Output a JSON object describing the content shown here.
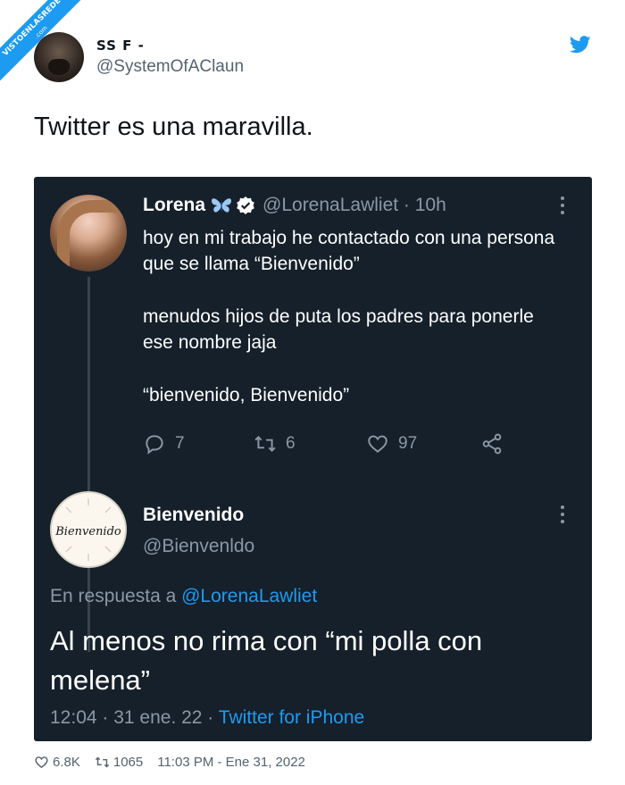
{
  "watermark": {
    "line1": "VISTOENLASREDES",
    "line2": ".com"
  },
  "outer_tweet": {
    "author_name": "SS F  -",
    "handle": "@SystemOfAClaun",
    "text": "Twitter es una maravilla.",
    "likes": "6.8K",
    "retweets": "1065",
    "timestamp": "11:03 PM - Ene 31, 2022"
  },
  "quoted_thread": {
    "first": {
      "author_name": "Lorena",
      "handle_time": "@LorenaLawliet · 10h",
      "paragraphs": [
        "hoy en mi trabajo he contactado con una persona que se llama “Bienvenido”",
        "menudos hijos de puta los padres para ponerle ese nombre jaja",
        "“bienvenido, Bienvenido”"
      ],
      "replies": "7",
      "retweets": "6",
      "likes": "97"
    },
    "reply": {
      "author_name": "Bienvenido",
      "handle": "@Bienvenldo",
      "avatar_text": "Bienvenido",
      "reply_prefix": "En respuesta a",
      "reply_mention": "@LorenaLawliet",
      "text": "Al menos no rima con “mi polla con melena”",
      "time_date": "12:04 · 31 ene. 22 ·",
      "client": "Twitter for iPhone"
    }
  },
  "colors": {
    "twitter_blue": "#1d9bf0",
    "dark_bg": "#15202b",
    "muted_text": "#8b98a5"
  }
}
